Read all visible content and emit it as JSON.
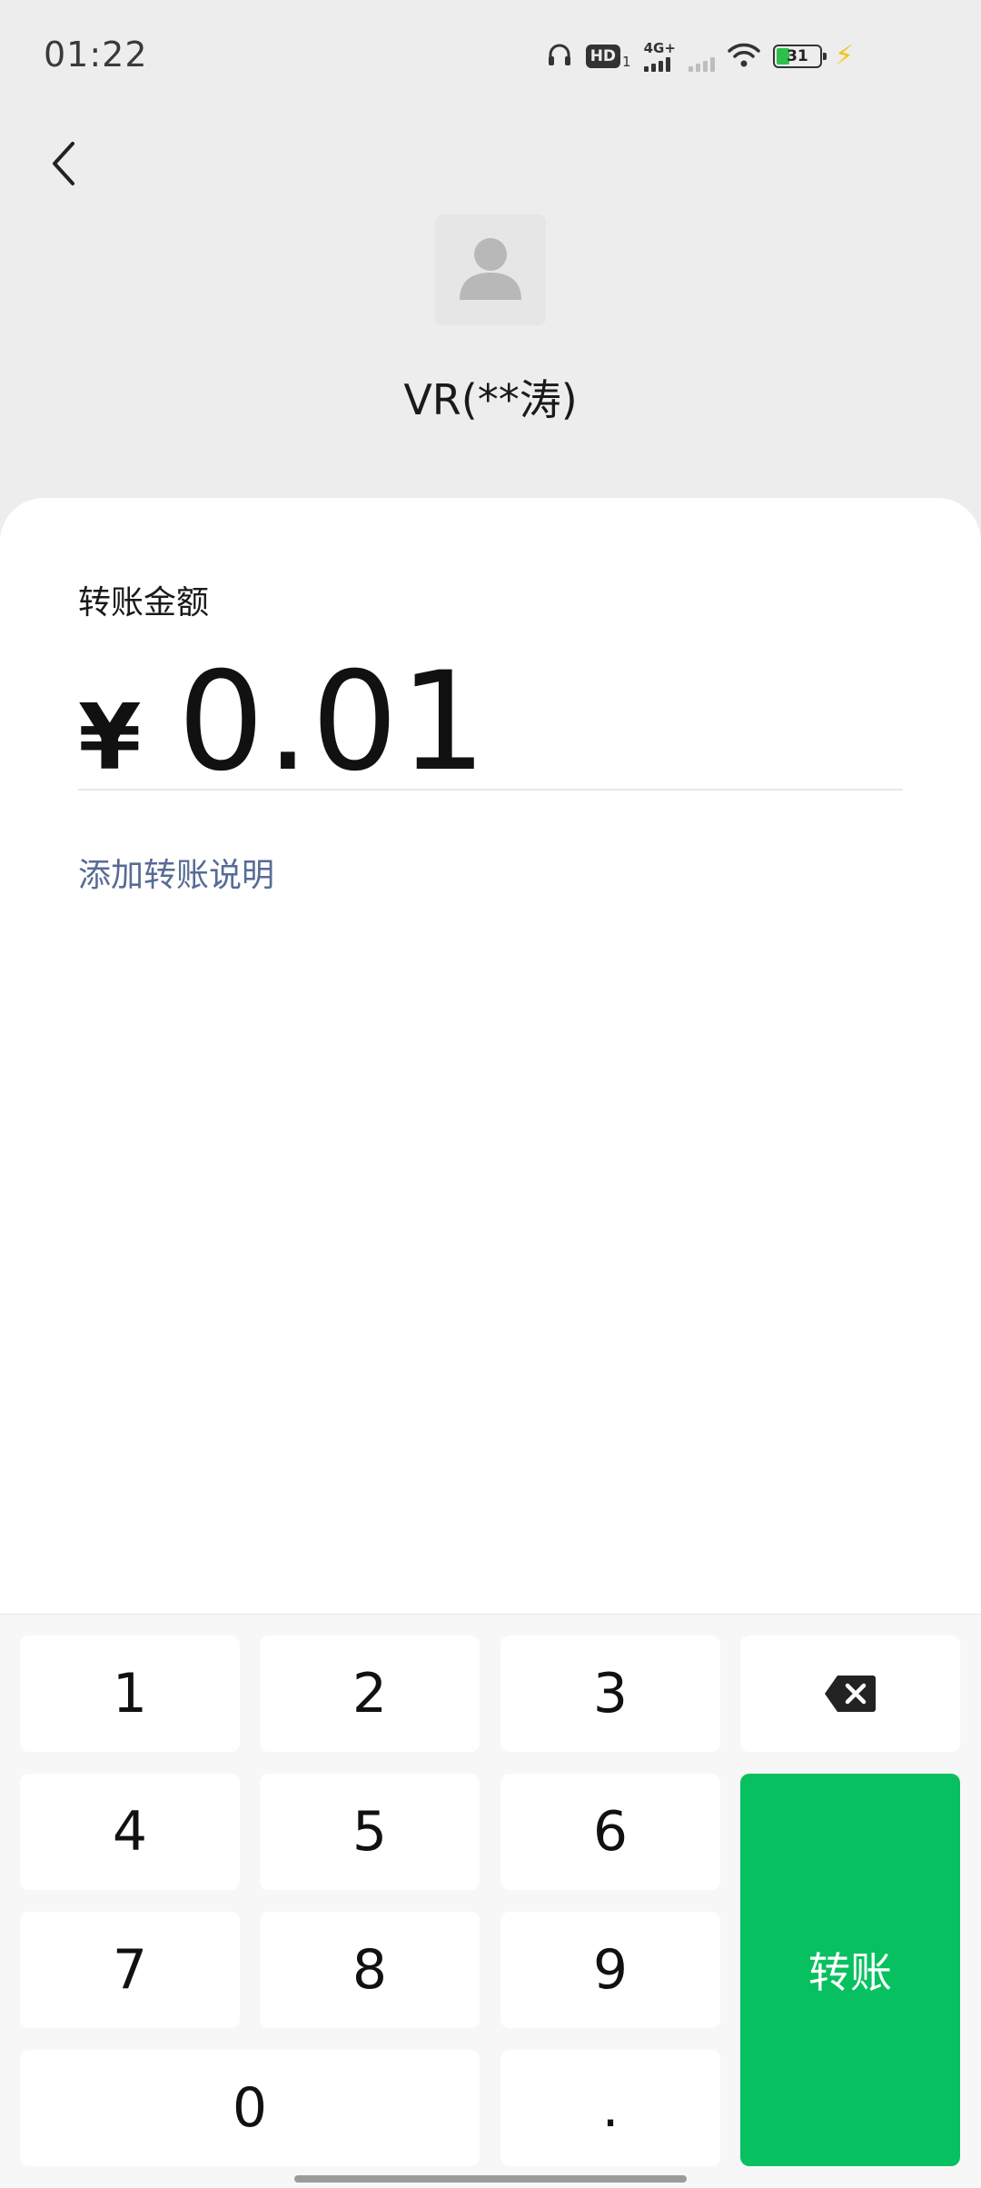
{
  "status_bar": {
    "time": "01:22",
    "hd_label": "HD",
    "hd_sub": "1",
    "network": "4G+",
    "battery_level": "31",
    "icons": [
      "headphones-icon",
      "hd-voice-icon",
      "signal-icon",
      "signal-icon",
      "wifi-icon",
      "battery-icon",
      "charging-icon"
    ]
  },
  "header": {
    "back_icon": "chevron-left-icon",
    "avatar_icon": "default-avatar-icon",
    "payee_name": "VR(**涛)"
  },
  "transfer": {
    "amount_label": "转账金额",
    "currency_symbol": "¥",
    "amount": "0.01",
    "add_note_link": "添加转账说明"
  },
  "keypad": {
    "keys": {
      "k1": "1",
      "k2": "2",
      "k3": "3",
      "k4": "4",
      "k5": "5",
      "k6": "6",
      "k7": "7",
      "k8": "8",
      "k9": "9",
      "k0": "0",
      "dot": "."
    },
    "backspace_icon": "backspace-icon",
    "confirm_label": "转账"
  },
  "colors": {
    "background": "#ededed",
    "card": "#ffffff",
    "accent_green": "#07c160",
    "link_blue": "#576b95",
    "keypad_bg": "#f7f7f7"
  }
}
